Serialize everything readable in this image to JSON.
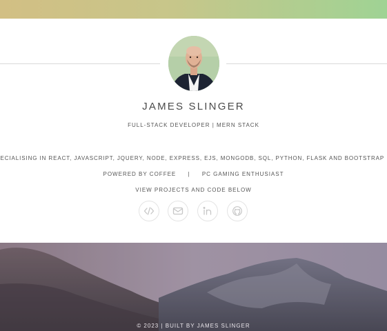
{
  "profile": {
    "name": "JAMES SLINGER",
    "subtitle": "FULL-STACK DEVELOPER | MERN STACK",
    "skills": "SPECIALISING IN REACT, JAVASCRIPT, JQUERY, NODE, EXPRESS, EJS, MONGODB, SQL, PYTHON, FLASK AND BOOTSTRAP",
    "powered_by": "POWERED BY COFFEE",
    "separator": "|",
    "hobby": "PC GAMING ENTHUSIAST",
    "cta": "VIEW PROJECTS AND CODE BELOW"
  },
  "social_links": [
    {
      "icon": "code-icon"
    },
    {
      "icon": "mail-icon"
    },
    {
      "icon": "linkedin-icon"
    },
    {
      "icon": "github-icon"
    }
  ],
  "footer": {
    "text": "© 2023 | BUILT BY JAMES SLINGER"
  },
  "colors": {
    "top_band_start": "#d2bf84",
    "top_band_end": "#9fd394",
    "text": "#555555",
    "icon": "#c9c9c9"
  }
}
